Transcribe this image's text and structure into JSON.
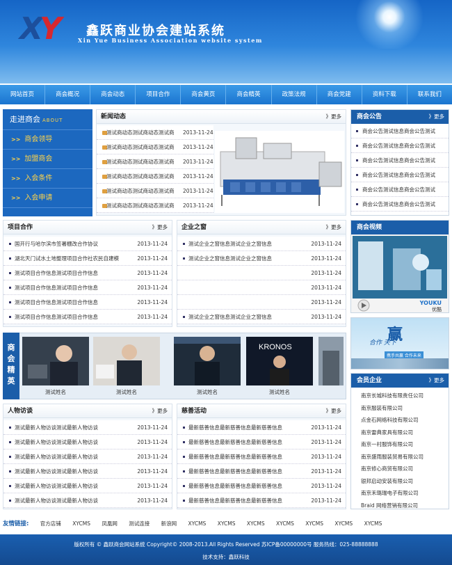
{
  "header": {
    "logo": "XY",
    "title": "鑫跃商业协会建站系统",
    "subtitle": "Xin Yue Business Association website system"
  },
  "nav": [
    "网站首页",
    "商会概况",
    "商会动态",
    "项目合作",
    "商会黄页",
    "商会精英",
    "政策法规",
    "商会党建",
    "资料下载",
    "联系我们"
  ],
  "left": {
    "title": "走进商会",
    "title_en": "ABOUT",
    "items": [
      "商会领导",
      "加盟商会",
      "入会条件",
      "入会申请"
    ],
    "arrow": ">>"
  },
  "news": {
    "title": "新闻动态",
    "more": "》更多",
    "rows": [
      {
        "text": "测试商动态测试商动态测试商",
        "date": "2013-11-24"
      },
      {
        "text": "测试商动态测试商动态测试商",
        "date": "2013-11-24"
      },
      {
        "text": "测试商动态测试商动态测试商",
        "date": "2013-11-24"
      },
      {
        "text": "测试商动态测试商动态测试商",
        "date": "2013-11-24"
      },
      {
        "text": "测试商动态测试商动态测试商",
        "date": "2013-11-24"
      },
      {
        "text": "测试商动态测试商动态测试商",
        "date": "2013-11-24"
      }
    ]
  },
  "notice": {
    "title": "商会公告",
    "more": "》更多",
    "rows": [
      "商会公告测试信息商会公告测试",
      "商会公告测试信息商会公告测试",
      "商会公告测试信息商会公告测试",
      "商会公告测试信息商会公告测试",
      "商会公告测试信息商会公告测试",
      "商会公告测试信息商会公告测试"
    ]
  },
  "projects": {
    "title": "项目合作",
    "more": "》更多",
    "rows": [
      {
        "text": "国开行与哈尔滨市签署棚改合作协议",
        "date": "2013-11-24"
      },
      {
        "text": "湖北天门试水土地整理项目合作社农民自建模",
        "date": "2013-11-24"
      },
      {
        "text": "测试项目合作信息测试项目合作信息",
        "date": "2013-11-24"
      },
      {
        "text": "测试项目合作信息测试项目合作信息",
        "date": "2013-11-24"
      },
      {
        "text": "测试项目合作信息测试项目合作信息",
        "date": "2013-11-24"
      },
      {
        "text": "测试项目合作信息测试项目合作信息",
        "date": "2013-11-24"
      }
    ]
  },
  "enterprise": {
    "title": "企业之窗",
    "more": "》更多",
    "rows": [
      {
        "text": "测试企业之窗信息测试企业之窗信息",
        "date": "2013-11-24"
      },
      {
        "text": "测试企业之窗信息测试企业之窗信息",
        "date": "2013-11-24"
      },
      {
        "text": "",
        "date": "2013-11-24"
      },
      {
        "text": "",
        "date": "2013-11-24"
      },
      {
        "text": "",
        "date": "2013-11-24"
      },
      {
        "text": "测试企业之窗信息测试企业之窗信息",
        "date": "2013-11-24"
      }
    ]
  },
  "video": {
    "title": "商会视频",
    "brand": "YOUKU",
    "brand_cn": "优酷"
  },
  "banner": {
    "big": "赢",
    "line": "合作 天下",
    "slogan": "携手共赢  合作未来"
  },
  "elite": {
    "label": "商会精英",
    "captions": [
      "测试姓名",
      "测试姓名",
      "测试姓名",
      "测试姓名"
    ],
    "sign": "KRONOS"
  },
  "members": {
    "title": "会员企业",
    "more": "》更多",
    "rows": [
      "南京长城科技有限责任公司",
      "南京服装有限公司",
      "点金石网络科技有限公司",
      "南京雷典家具有限公司",
      "南京一村服饰有限公司",
      "南京盛雨服装贸易有限公司",
      "南京修心商贸有限公司",
      "银邦启动安装有限公司",
      "南京禾璐瑞电子有限公司",
      "Braid 网络营销有限公司"
    ]
  },
  "interviews": {
    "title": "人物访谈",
    "more": "》更多",
    "rows": [
      {
        "text": "测试最新人物访谈测试最新人物访谈",
        "date": "2013-11-24"
      },
      {
        "text": "测试最新人物访谈测试最新人物访谈",
        "date": "2013-11-24"
      },
      {
        "text": "测试最新人物访谈测试最新人物访谈",
        "date": "2013-11-24"
      },
      {
        "text": "测试最新人物访谈测试最新人物访谈",
        "date": "2013-11-24"
      },
      {
        "text": "测试最新人物访谈测试最新人物访谈",
        "date": "2013-11-24"
      },
      {
        "text": "测试最新人物访谈测试最新人物访谈",
        "date": "2013-11-24"
      }
    ]
  },
  "charity": {
    "title": "慈善活动",
    "more": "》更多",
    "rows": [
      {
        "text": "最新慈善信息最新慈善信息最新慈善信息",
        "date": "2013-11-24"
      },
      {
        "text": "最新慈善信息最新慈善信息最新慈善信息",
        "date": "2013-11-24"
      },
      {
        "text": "最新慈善信息最新慈善信息最新慈善信息",
        "date": "2013-11-24"
      },
      {
        "text": "最新慈善信息最新慈善信息最新慈善信息",
        "date": "2013-11-24"
      },
      {
        "text": "最新慈善信息最新慈善信息最新慈善信息",
        "date": "2013-11-24"
      },
      {
        "text": "最新慈善信息最新慈善信息最新慈善信息",
        "date": "2013-11-24"
      }
    ]
  },
  "links": {
    "label": "友情链接:",
    "items": [
      "官方店铺",
      "XYCMS",
      "凤凰网",
      "测试连接",
      "新浪网",
      "XYCMS",
      "XYCMS",
      "XYCMS",
      "XYCMS",
      "XYCMS",
      "XYCMS",
      "XYCMS"
    ]
  },
  "footer": {
    "line1": "版权所有 © 鑫跃商会网站系统 Copyright© 2008-2013.All Rights Reserved 苏ICP备00000000号 服务热线：025-88888888",
    "line2": "技术支持：鑫跃科技"
  }
}
